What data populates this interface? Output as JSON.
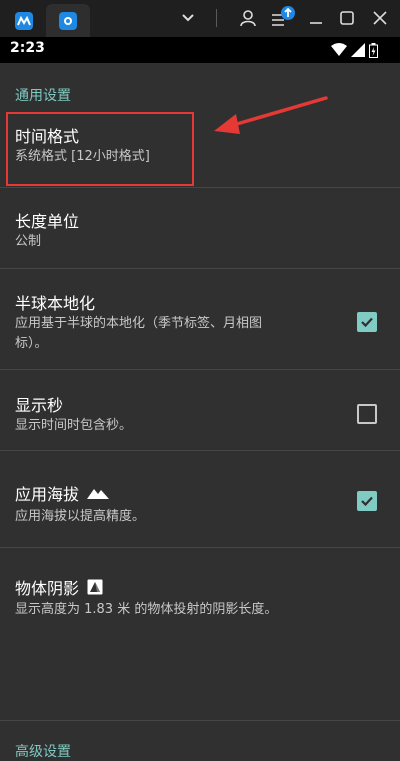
{
  "browser": {
    "tabs": [
      {
        "icon": "app-logo-icon",
        "active": false
      },
      {
        "icon": "app-logo-icon",
        "active": true
      }
    ],
    "controls": [
      "chevron-down-icon",
      "profile-icon",
      "menu-update-icon",
      "minimize-icon",
      "maximize-icon",
      "close-icon"
    ]
  },
  "status_bar": {
    "time": "2:23",
    "icons": [
      "wifi-icon",
      "signal-icon",
      "battery-icon"
    ]
  },
  "sections": {
    "general_header": "通用设置",
    "advanced_header": "高级设置"
  },
  "prefs": {
    "time_format": {
      "title": "时间格式",
      "summary": "系统格式 [12小时格式]"
    },
    "length_unit": {
      "title": "长度单位",
      "summary": "公制"
    },
    "hemisphere": {
      "title": "半球本地化",
      "summary_line1": "应用基于半球的本地化（季节标签、月相图",
      "summary_line2": "标）。",
      "checked": true
    },
    "show_seconds": {
      "title": "显示秒",
      "summary": "显示时间时包含秒。",
      "checked": false
    },
    "altitude": {
      "title": "应用海拔",
      "summary": "应用海拔以提高精度。",
      "checked": true
    },
    "shadow": {
      "title": "物体阴影",
      "summary": "显示高度为 1.83 米 的物体投射的阴影长度。"
    }
  },
  "colors": {
    "accent": "#80cbc4",
    "annotation": "#e53935",
    "background": "#303030"
  }
}
